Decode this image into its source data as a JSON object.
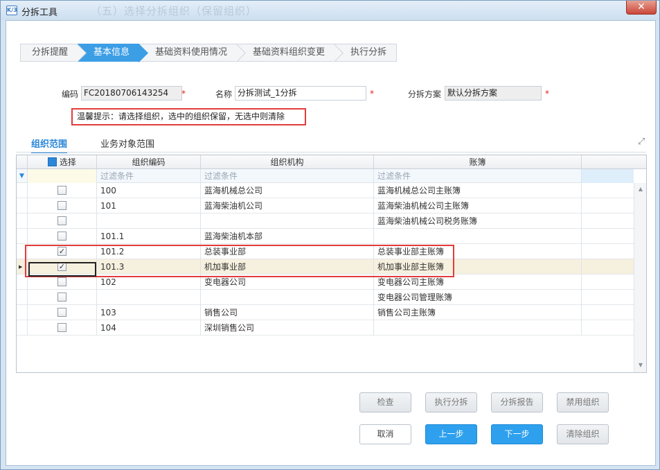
{
  "window": {
    "title": "分拆工具",
    "ghost_title": "（五）选择分拆组织（保留组织）",
    "app_icon": "K/3",
    "close_glyph": "✕"
  },
  "steps": [
    "分拆提醒",
    "基本信息",
    "基础资料使用情况",
    "基础资料组织变更",
    "执行分拆"
  ],
  "form": {
    "code_label": "编码",
    "code_value": "FC20180706143254",
    "name_label": "名称",
    "name_value": "分拆测试_1分拆",
    "scheme_label": "分拆方案",
    "scheme_value": "默认分拆方案",
    "required_mark": "*"
  },
  "tip": "温馨提示：请选择组织，选中的组织保留，无选中则清除",
  "tabs": [
    "组织范围",
    "业务对象范围"
  ],
  "grid": {
    "headers": {
      "select": "选择",
      "code": "组织编码",
      "org": "组织机构",
      "book": "账簿"
    },
    "filter_placeholder": "过滤条件",
    "rows": [
      {
        "checked": false,
        "code": "100",
        "org": "蓝海机械总公司",
        "book": "蓝海机械总公司主账簿"
      },
      {
        "checked": false,
        "code": "101",
        "org": "蓝海柴油机公司",
        "book": "蓝海柴油机械公司主账簿"
      },
      {
        "checked": false,
        "code": "",
        "org": "",
        "book": "蓝海柴油机械公司税务账簿"
      },
      {
        "checked": false,
        "code": "101.1",
        "org": "蓝海柴油机本部",
        "book": ""
      },
      {
        "checked": true,
        "code": "101.2",
        "org": "总装事业部",
        "book": "总装事业部主账簿"
      },
      {
        "checked": true,
        "code": "101.3",
        "org": "机加事业部",
        "book": "机加事业部主账簿"
      },
      {
        "checked": false,
        "code": "102",
        "org": "变电器公司",
        "book": "变电器公司主账簿"
      },
      {
        "checked": false,
        "code": "",
        "org": "",
        "book": "变电器公司管理账簿"
      },
      {
        "checked": false,
        "code": "103",
        "org": "销售公司",
        "book": "销售公司主账簿"
      },
      {
        "checked": false,
        "code": "104",
        "org": "深圳销售公司",
        "book": ""
      }
    ]
  },
  "buttons": {
    "check": "检查",
    "execute": "执行分拆",
    "report": "分拆报告",
    "disable_org": "禁用组织",
    "cancel": "取消",
    "prev": "上一步",
    "next": "下一步",
    "clear_org": "清除组织"
  },
  "colors": {
    "accent": "#2ea0ee",
    "highlight": "#e23b3b",
    "current_row": "#f6f0de"
  }
}
